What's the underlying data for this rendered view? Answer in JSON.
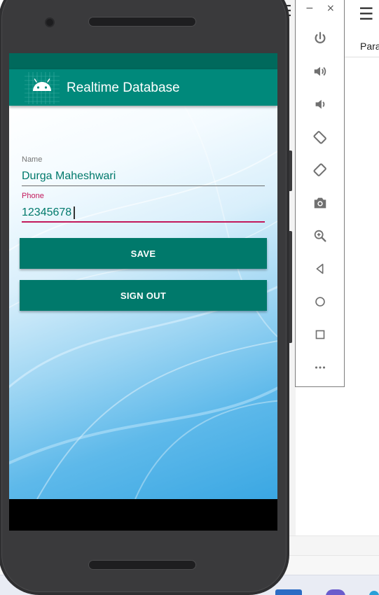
{
  "app": {
    "title": "Realtime Database",
    "logo_icon": "android-icon"
  },
  "form": {
    "name_label": "Name",
    "name_value": "Durga Maheshwari",
    "phone_label": "Phone",
    "phone_value": "12345678"
  },
  "buttons": {
    "save_label": "SAVE",
    "signout_label": "SIGN OUT"
  },
  "emulator_toolbar": {
    "minimize_icon": "minimize-icon",
    "close_icon": "close-icon",
    "items": [
      "power-icon",
      "volume-up-icon",
      "volume-down-icon",
      "rotate-left-icon",
      "rotate-right-icon",
      "camera-icon",
      "zoom-icon",
      "back-icon",
      "home-icon",
      "overview-icon",
      "more-icon"
    ]
  },
  "ide": {
    "partial_text": "Para"
  },
  "colors": {
    "primary": "#00897b",
    "primary_dark": "#00695c",
    "button": "#00796b",
    "accent": "#c2185b",
    "input_text": "#00796b"
  }
}
